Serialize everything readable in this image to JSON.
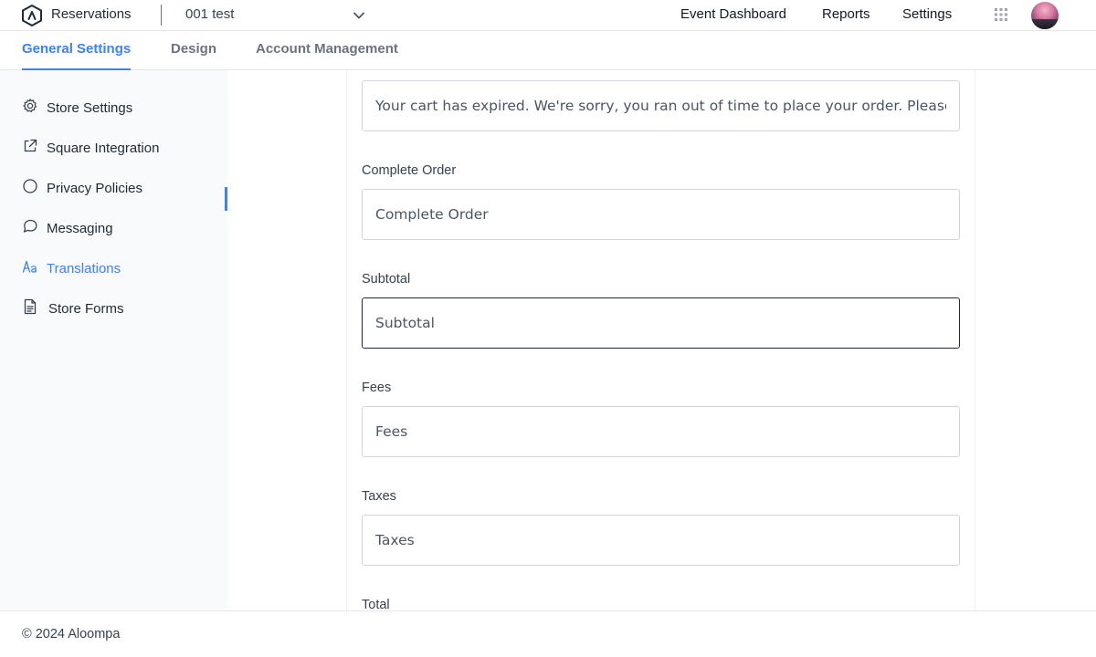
{
  "header": {
    "app_name": "Reservations",
    "store_selected": "001 test",
    "nav": [
      "Event Dashboard",
      "Reports",
      "Settings"
    ],
    "icons": [
      "logo-icon",
      "chevron-down-icon",
      "apps-grid-icon",
      "avatar"
    ]
  },
  "tabs": [
    {
      "label": "General Settings",
      "active": true
    },
    {
      "label": "Design",
      "active": false
    },
    {
      "label": "Account Management",
      "active": false
    }
  ],
  "sidebar": {
    "items": [
      {
        "label": "Store Settings",
        "icon": "gear-icon"
      },
      {
        "label": "Square Integration",
        "icon": "external-link-icon"
      },
      {
        "label": "Privacy Policies",
        "icon": "circle-icon"
      },
      {
        "label": "Messaging",
        "icon": "chat-bubble-icon"
      },
      {
        "label": "Translations",
        "icon": "translate-icon",
        "active": true
      },
      {
        "label": "Store Forms",
        "icon": "document-icon"
      }
    ]
  },
  "form": {
    "cart_expired_value": "Your cart has expired. We're sorry, you ran out of time to place your order. Please try again.",
    "fields": [
      {
        "label": "Complete Order",
        "value": "Complete Order"
      },
      {
        "label": "Subtotal",
        "value": "Subtotal",
        "focused": true
      },
      {
        "label": "Fees",
        "value": "Fees"
      },
      {
        "label": "Taxes",
        "value": "Taxes"
      },
      {
        "label": "Total"
      }
    ]
  },
  "footer": {
    "copyright": "© 2024 Aloompa"
  },
  "colors": {
    "accent": "#3b82f6",
    "sidebar_bg": "#f9fafb",
    "border": "#d1d5db"
  }
}
